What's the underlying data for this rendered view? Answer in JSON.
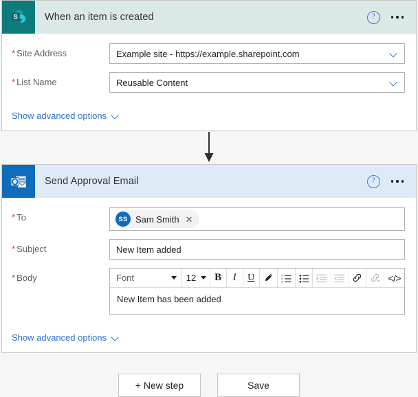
{
  "steps": [
    {
      "id": "trigger",
      "icon": "sharepoint-icon",
      "title": "When an item is created",
      "help_icon": "help-circle-icon",
      "more_icon": "ellipsis-menu-icon",
      "fields": [
        {
          "label": "Site Address",
          "required_marker": "*",
          "value": "Example site - https://example.sharepoint.com",
          "control": "dropdown",
          "chevron_icon": "chevron-down-icon"
        },
        {
          "label": "List Name",
          "required_marker": "*",
          "value": "Reusable Content",
          "control": "dropdown",
          "chevron_icon": "chevron-down-icon"
        }
      ],
      "advanced_options_label": "Show advanced options",
      "advanced_chevron_icon": "chevron-down-icon"
    },
    {
      "id": "action",
      "icon": "outlook-icon",
      "title": "Send Approval Email",
      "help_icon": "help-circle-icon",
      "more_icon": "ellipsis-menu-icon",
      "fields": [
        {
          "label": "To",
          "required_marker": "*",
          "control": "people-picker",
          "person": {
            "initials": "SS",
            "name": "Sam Smith",
            "remove_icon": "close-icon"
          }
        },
        {
          "label": "Subject",
          "required_marker": "*",
          "value": "New Item added",
          "control": "text"
        },
        {
          "label": "Body",
          "required_marker": "*",
          "control": "rich-text",
          "value": "New Item has been added"
        }
      ],
      "advanced_options_label": "Show advanced options",
      "advanced_chevron_icon": "chevron-down-icon"
    }
  ],
  "rich_text_toolbar": {
    "font_name": "Font",
    "font_size": "12",
    "buttons": [
      {
        "name": "bold-icon",
        "label": "B",
        "disabled": false
      },
      {
        "name": "italic-icon",
        "label": "I",
        "disabled": false
      },
      {
        "name": "underline-icon",
        "label": "U",
        "disabled": false
      },
      {
        "name": "text-color-pen-icon",
        "label": "",
        "disabled": false
      },
      {
        "name": "numbered-list-icon",
        "label": "",
        "disabled": false
      },
      {
        "name": "bulleted-list-icon",
        "label": "",
        "disabled": false
      },
      {
        "name": "indent-increase-icon",
        "label": "",
        "disabled": true
      },
      {
        "name": "indent-decrease-icon",
        "label": "",
        "disabled": true
      },
      {
        "name": "insert-link-icon",
        "label": "",
        "disabled": false
      },
      {
        "name": "remove-link-icon",
        "label": "",
        "disabled": true
      },
      {
        "name": "code-view-icon",
        "label": "</>",
        "disabled": false
      }
    ]
  },
  "connector": {
    "icon": "arrow-down-icon"
  },
  "footer": {
    "new_step_label": "+ New step",
    "save_label": "Save"
  },
  "colors": {
    "sharepoint_teal": "#0d7b7b",
    "sharepoint_header": "#dbe8e8",
    "outlook_blue": "#0f6cbd",
    "outlook_header": "#deebf7",
    "link_blue": "#2b6fd6",
    "required_red": "#c4443c",
    "canvas_bg": "#f6f6f6"
  }
}
